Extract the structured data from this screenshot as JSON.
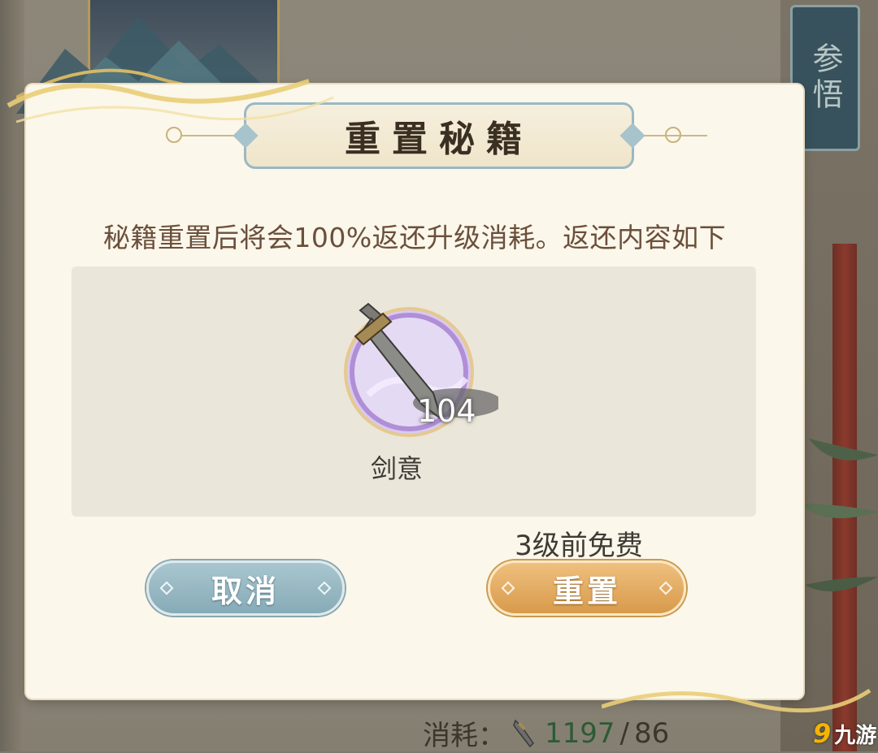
{
  "background": {
    "side_tab_label": "参悟",
    "cost_label": "消耗：",
    "cost_current": "1197",
    "cost_separator": "/",
    "cost_max": "86"
  },
  "watermark": {
    "mark": "9",
    "text": "九游"
  },
  "dialog": {
    "title": "重置秘籍",
    "description": "秘籍重置后将会100%返还升级消耗。返还内容如下",
    "rewards": [
      {
        "name": "剑意",
        "count": "104",
        "icon": "sword-icon"
      }
    ],
    "free_note": "3级前免费",
    "cancel_label": "取消",
    "reset_label": "重置"
  },
  "colors": {
    "dialog_bg": "#fbf7ea",
    "cancel_button": "#86abb7",
    "reset_button": "#d89a4a",
    "description_text": "#6b4f3c",
    "item_frame": "#b08fd6"
  }
}
